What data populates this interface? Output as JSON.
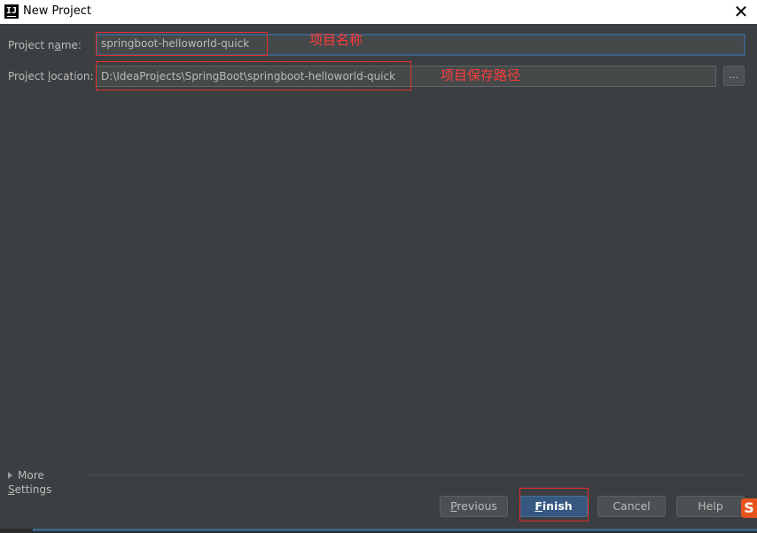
{
  "window": {
    "title": "New Project",
    "app_icon": "intellij-logo-icon",
    "app_icon_text": "IJ",
    "close_icon": "close-icon",
    "close_glyph": "✕"
  },
  "form": {
    "project_name": {
      "label_pre": "Project n",
      "label_mn": "a",
      "label_post": "me:",
      "value": "springboot-helloworld-quick"
    },
    "project_location": {
      "label_pre": "Project ",
      "label_mn": "l",
      "label_post": "ocation:",
      "value": "D:\\IdeaProjects\\SpringBoot\\springboot-helloworld-quick",
      "browse_label": "..."
    }
  },
  "annotations": {
    "name_note": "项目名称",
    "location_note": "项目保存路径",
    "highlight_color": "#e62c2c"
  },
  "more_settings": {
    "label_pre": "More ",
    "label_mn": "S",
    "label_post": "ettings",
    "icon": "expand-triangle-icon"
  },
  "buttons": {
    "previous": {
      "mn": "P",
      "rest": "revious"
    },
    "finish": {
      "mn": "F",
      "rest": "inish"
    },
    "cancel": "Cancel",
    "help": "Help"
  },
  "tray": {
    "s_icon": "S"
  },
  "colors": {
    "background": "#3c3f41",
    "primary_button": "#365880",
    "focus_border": "#3d6185"
  }
}
